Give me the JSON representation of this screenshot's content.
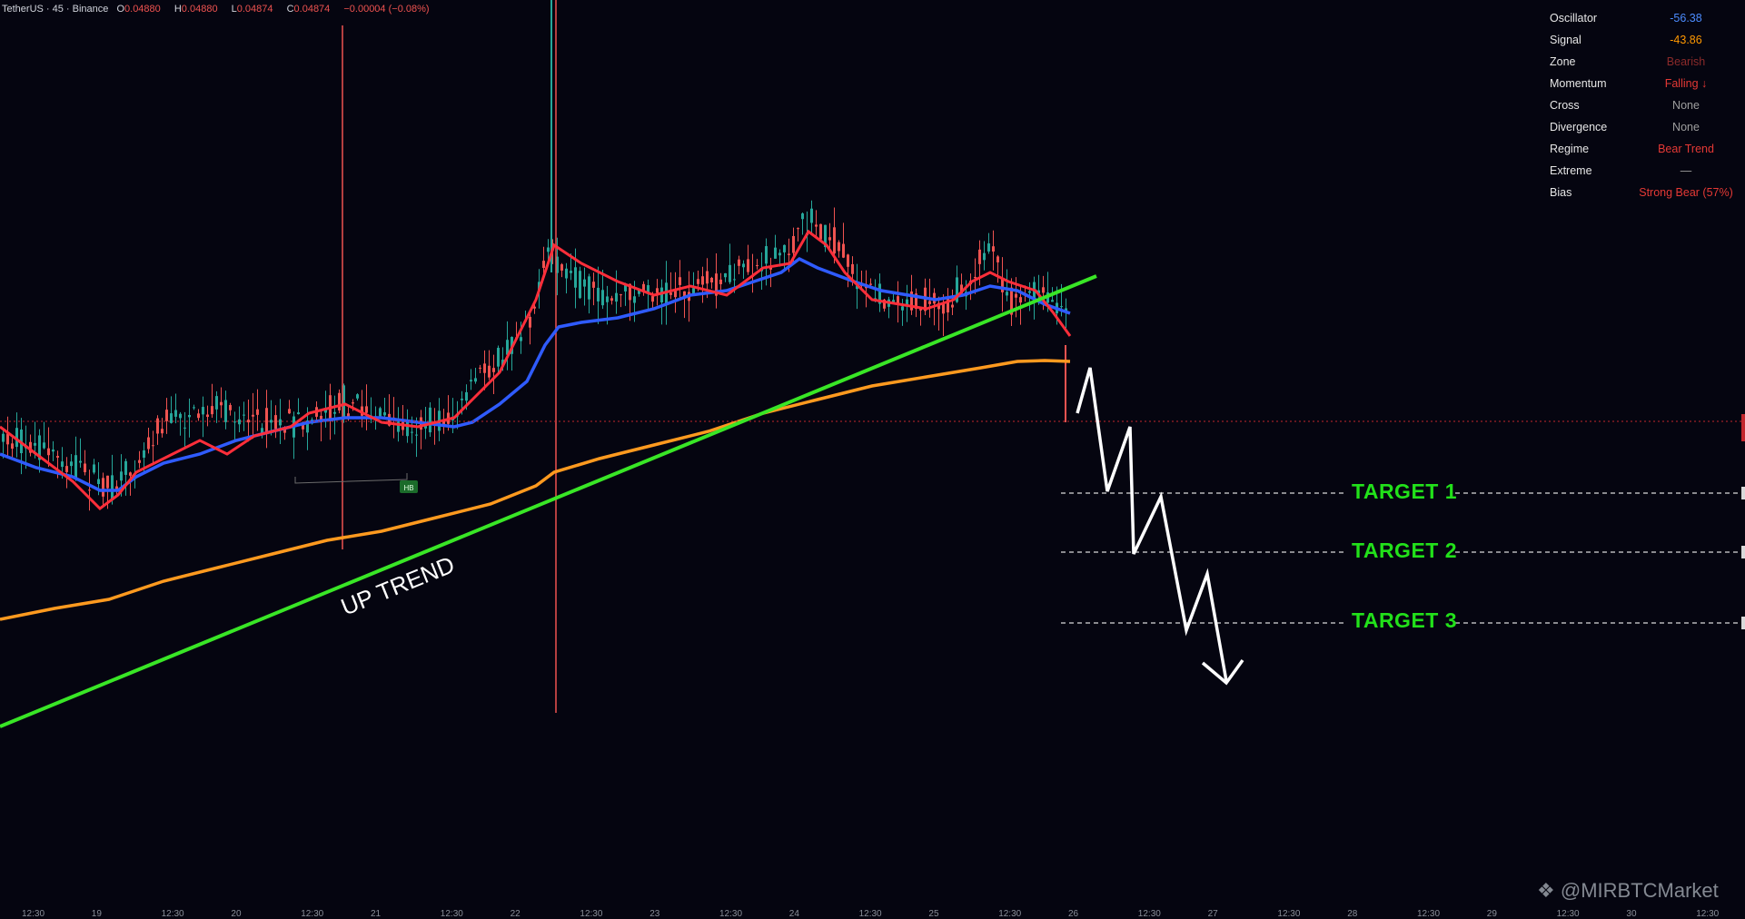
{
  "header": {
    "symbol": "TetherUS · 45 · Binance",
    "open_label": "O",
    "open": "0.04880",
    "high_label": "H",
    "high": "0.04880",
    "low_label": "L",
    "low": "0.04874",
    "close_label": "C",
    "close": "0.04874",
    "change": "−0.00004 (−0.08%)"
  },
  "panel": [
    {
      "key": "Oscillator",
      "value": "-56.38",
      "color": "#4c8cff"
    },
    {
      "key": "Signal",
      "value": "-43.86",
      "color": "#ff9800"
    },
    {
      "key": "Zone",
      "value": "Bearish",
      "color": "#8b2a2a"
    },
    {
      "key": "Momentum",
      "value": "Falling ↓",
      "color": "#e53935"
    },
    {
      "key": "Cross",
      "value": "None",
      "color": "#9e9e9e"
    },
    {
      "key": "Divergence",
      "value": "None",
      "color": "#9e9e9e"
    },
    {
      "key": "Regime",
      "value": "Bear Trend",
      "color": "#e53935"
    },
    {
      "key": "Extreme",
      "value": "—",
      "color": "#9e9e9e"
    },
    {
      "key": "Bias",
      "value": "Strong Bear (57%)",
      "color": "#e53935"
    }
  ],
  "annotations": {
    "trend_label": "UP TREND",
    "targets": [
      "TARGET 1",
      "TARGET 2",
      "TARGET 3"
    ],
    "marker_label": "HB",
    "watermark": "@MIRBTCMarket"
  },
  "chart_data": {
    "type": "candlestick",
    "series": [
      {
        "name": "EMA fast",
        "color": "#ff2e3a"
      },
      {
        "name": "EMA mid",
        "color": "#2f5bff"
      },
      {
        "name": "EMA slow",
        "color": "#ff9a1f"
      }
    ],
    "x_ticks": [
      "12:30",
      "19",
      "12:30",
      "20",
      "12:30",
      "21",
      "12:30",
      "22",
      "12:30",
      "23",
      "12:30",
      "24",
      "12:30",
      "25",
      "12:30",
      "26",
      "12:30",
      "27",
      "12:30",
      "28",
      "12:30",
      "29",
      "12:30",
      "30",
      "12:30"
    ],
    "colors": {
      "up": "#26a69a",
      "down": "#ef5350",
      "trendline": "#39e626",
      "background": "#050510"
    }
  }
}
